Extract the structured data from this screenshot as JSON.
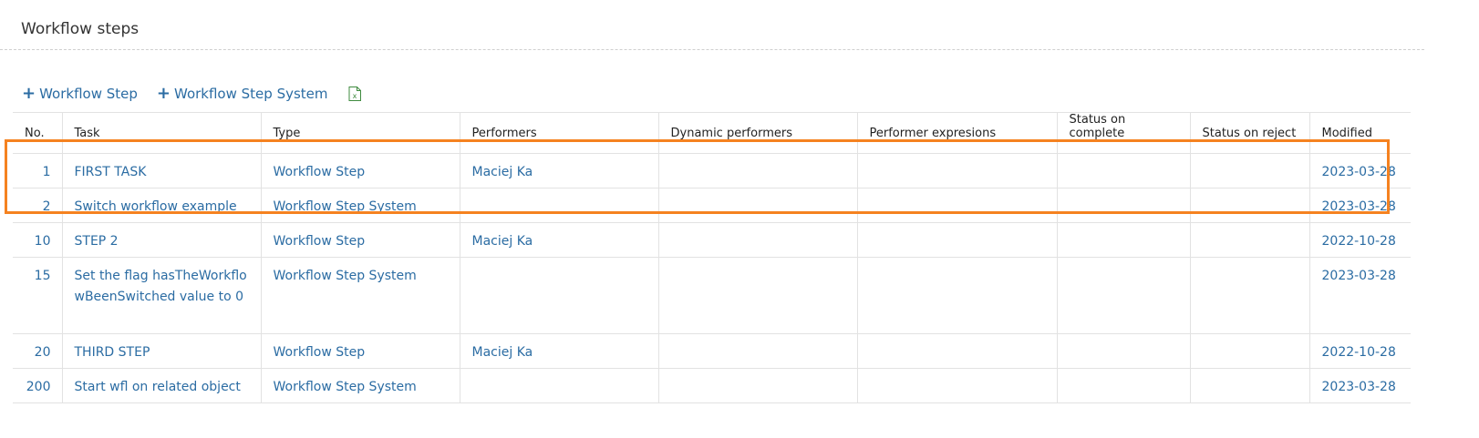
{
  "section": {
    "title": "Workflow steps"
  },
  "toolbar": {
    "add_step_label": "Workflow Step",
    "add_step_system_label": "Workflow Step System",
    "export_icon": "excel-export-icon",
    "accent_color": "#2b6ca3"
  },
  "table": {
    "columns": {
      "no": "No.",
      "task": "Task",
      "type": "Type",
      "performers": "Performers",
      "dynamic_performers": "Dynamic performers",
      "performer_expresions": "Performer expresions",
      "status_on_complete": "Status on complete",
      "status_on_reject": "Status on reject",
      "modified": "Modified"
    },
    "rows": [
      {
        "no": "1",
        "task": "FIRST TASK",
        "type": "Workflow Step",
        "performers": "Maciej Ka",
        "dynamic_performers": "",
        "performer_expresions": "",
        "status_on_complete": "",
        "status_on_reject": "",
        "modified": "2023-03-28"
      },
      {
        "no": "2",
        "task": "Switch workflow example",
        "type": "Workflow Step System",
        "performers": "",
        "dynamic_performers": "",
        "performer_expresions": "",
        "status_on_complete": "",
        "status_on_reject": "",
        "modified": "2023-03-28"
      },
      {
        "no": "10",
        "task": "STEP 2",
        "type": "Workflow Step",
        "performers": "Maciej Ka",
        "dynamic_performers": "",
        "performer_expresions": "",
        "status_on_complete": "",
        "status_on_reject": "",
        "modified": "2022-10-28"
      },
      {
        "no": "15",
        "task": "Set the flag hasTheWorkflowBeenSwitched value to 0",
        "type": "Workflow Step System",
        "performers": "",
        "dynamic_performers": "",
        "performer_expresions": "",
        "status_on_complete": "",
        "status_on_reject": "",
        "modified": "2023-03-28"
      },
      {
        "no": "20",
        "task": "THIRD STEP",
        "type": "Workflow Step",
        "performers": "Maciej Ka",
        "dynamic_performers": "",
        "performer_expresions": "",
        "status_on_complete": "",
        "status_on_reject": "",
        "modified": "2022-10-28"
      },
      {
        "no": "200",
        "task": "Start wfl on related object",
        "type": "Workflow Step System",
        "performers": "",
        "dynamic_performers": "",
        "performer_expresions": "",
        "status_on_complete": "",
        "status_on_reject": "",
        "modified": "2023-03-28"
      }
    ]
  },
  "highlight": {
    "color": "#f58220"
  }
}
